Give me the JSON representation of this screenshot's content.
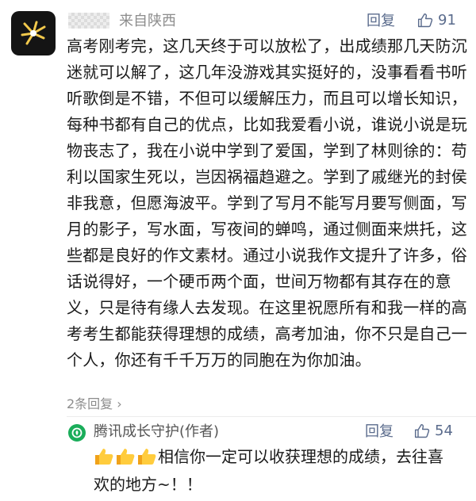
{
  "comment": {
    "location": "来自陕西",
    "reply_label": "回复",
    "like_count": "91",
    "text": "高考刚考完，这几天终于可以放松了，出成绩那几天防沉迷就可以解了，这几年没游戏其实挺好的，没事看看书听听歌倒是不错，不但可以缓解压力，而且可以增长知识，每种书都有自己的优点，比如我爱看小说，谁说小说是玩物丧志了，我在小说中学到了爱国，学到了林则徐的：苟利以国家生死以，岂因祸福趋避之。学到了戚继光的封侯非我意，但愿海波平。学到了写月不能写月要写侧面，写月的影子，写水面，写夜间的蝉鸣，通过侧面来烘托，这些都是良好的作文素材。通过小说我作文提升了许多，俗话说得好，一个硬币两个面，世间万物都有其存在的意义，只是待有缘人去发现。在这里祝愿所有和我一样的高考考生都能获得理想的成绩，高考加油，你不只是自己一个人，你还有千千万万的同胞在为你加油。",
    "replies_link": "2条回复"
  },
  "author_reply": {
    "name": "腾讯成长守护(作者)",
    "reply_label": "回复",
    "like_count": "54",
    "text": "相信你一定可以收获理想的成绩，去往喜欢的地方~！！"
  },
  "icons": {
    "avatar": "firework-sparkle-icon",
    "like": "thumbs-up-outline-icon",
    "author_avatar": "shield-leaf-icon",
    "emoji": "thumbs-up-emoji-icon",
    "chevron": "chevron-right-icon"
  },
  "colors": {
    "link": "#5a6b8c",
    "muted": "#8c8c8c",
    "author_green": "#1aad5a"
  }
}
